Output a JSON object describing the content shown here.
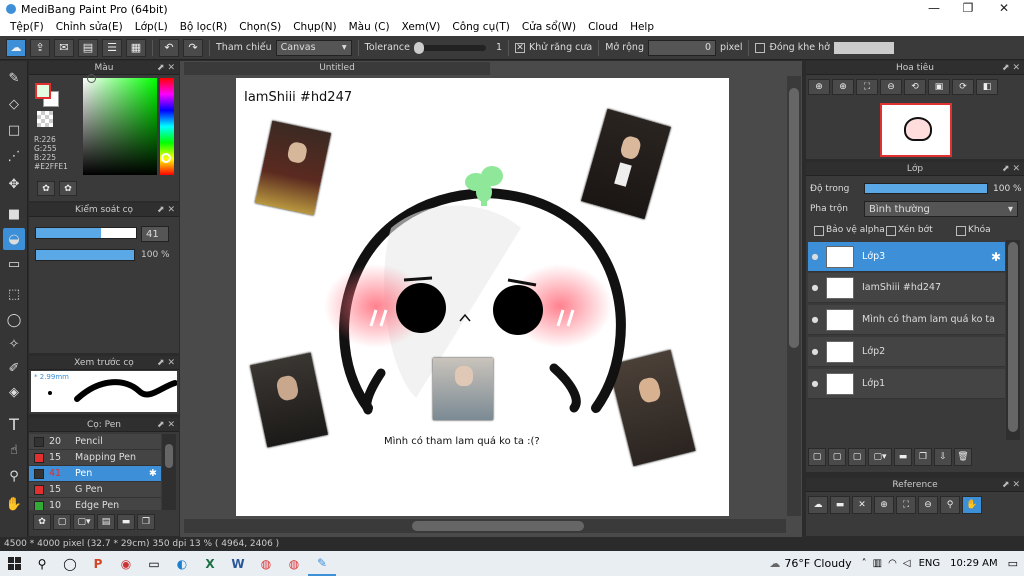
{
  "window": {
    "title": "MediBang Paint Pro (64bit)"
  },
  "menu": [
    "Tệp(F)",
    "Chỉnh sửa(E)",
    "Lớp(L)",
    "Bộ lọc(R)",
    "Chọn(S)",
    "Chụp(N)",
    "Màu (C)",
    "Xem(V)",
    "Công cụ(T)",
    "Cửa sổ(W)",
    "Cloud",
    "Help"
  ],
  "toolbar": {
    "ref_label": "Tham chiếu",
    "ref_value": "Canvas",
    "tolerance_label": "Tolerance",
    "tolerance_value": "1",
    "antialias_label": "Khử răng cưa",
    "expand_label": "Mở rộng",
    "expand_value": "0",
    "expand_unit": "pixel",
    "close_gap_label": "Đóng khe hở"
  },
  "color_panel": {
    "title": "Màu",
    "r": "R:226",
    "g": "G:255",
    "b": "B:225",
    "hex": "#E2FFE1",
    "fg_color": "#e2ffe1"
  },
  "brush_control": {
    "title": "Kiểm soát cọ",
    "size": "41",
    "opacity": "100 %",
    "size_fraction": 0.65,
    "opacity_fraction": 1.0
  },
  "brush_preview": {
    "title": "Xem trước cọ",
    "size_label": "2.99mm"
  },
  "brush_list": {
    "title": "Cọ: Pen",
    "items": [
      {
        "size": "20",
        "name": "Pencil",
        "color": "#333"
      },
      {
        "size": "15",
        "name": "Mapping Pen",
        "color": "#e03030"
      },
      {
        "size": "41",
        "name": "Pen",
        "color": "#333"
      },
      {
        "size": "15",
        "name": "G Pen",
        "color": "#e03030"
      },
      {
        "size": "10",
        "name": "Edge Pen",
        "color": "#33aa33"
      }
    ]
  },
  "document": {
    "tab_title": "Untitled"
  },
  "canvas_content": {
    "top_text": "IamShiii #hd247",
    "caption": "Mình có tham lam quá ko ta :(?"
  },
  "navigator": {
    "title": "Hoa tiêu"
  },
  "layer_panel": {
    "title": "Lớp",
    "opacity_label": "Độ trong",
    "opacity_value": "100 %",
    "blend_label": "Pha trộn",
    "blend_value": "Bình thường",
    "protect_alpha": "Bảo vệ alpha",
    "clipping": "Xén bớt",
    "lock": "Khóa",
    "layers": [
      {
        "name": "Lớp3"
      },
      {
        "name": "IamShiii #hd247"
      },
      {
        "name": "Mình có tham lam quá ko ta"
      },
      {
        "name": "Lớp2"
      },
      {
        "name": "Lớp1"
      }
    ]
  },
  "reference_panel": {
    "title": "Reference"
  },
  "status": {
    "text": "4500 * 4000 pixel  (32.7 * 29cm)  350 dpi  13 %  ( 4964, 2406 )"
  },
  "taskbar": {
    "weather": "76°F  Cloudy",
    "lang": "ENG",
    "time": "10:29 AM"
  }
}
